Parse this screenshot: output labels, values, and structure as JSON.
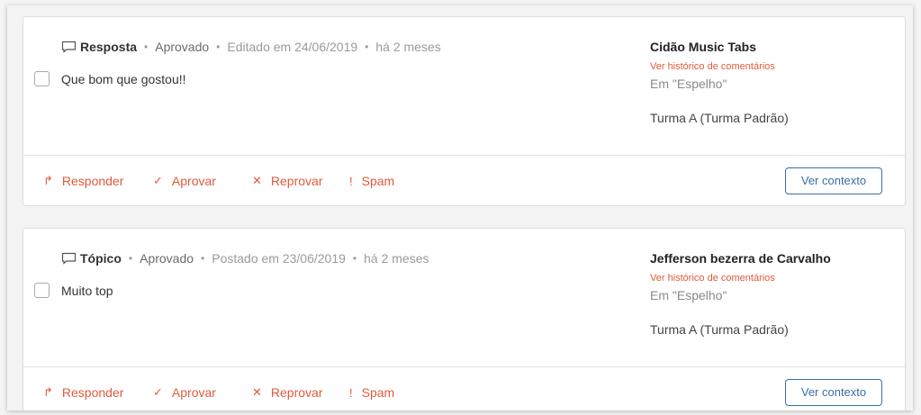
{
  "comments": [
    {
      "type": "Resposta",
      "status": "Aprovado",
      "edited": "Editado em 24/06/2019",
      "ago": "há 2 meses",
      "text": "Que bom que gostou!!",
      "author": "Cidão Music Tabs",
      "history_link": "Ver histórico de comentários",
      "where": "Em \"Espelho\"",
      "group": "Turma A (Turma Padrão)"
    },
    {
      "type": "Tópico",
      "status": "Aprovado",
      "edited": "Postado em 23/06/2019",
      "ago": "há 2 meses",
      "text": "Muito top",
      "author": "Jefferson bezerra de Carvalho",
      "history_link": "Ver histórico de comentários",
      "where": "Em \"Espelho\"",
      "group": "Turma A (Turma Padrão)"
    }
  ],
  "actions": {
    "reply_icon": "↱",
    "reply": "Responder",
    "approve_icon": "✓",
    "approve": "Aprovar",
    "reject_icon": "✕",
    "reject": "Reprovar",
    "spam_icon": "!",
    "spam": "Spam",
    "context": "Ver contexto"
  },
  "colors": {
    "accent": "#e05b3c",
    "link_blue": "#3b6ea5"
  },
  "icons": {
    "type_icon": "comment-bubble-icon"
  }
}
